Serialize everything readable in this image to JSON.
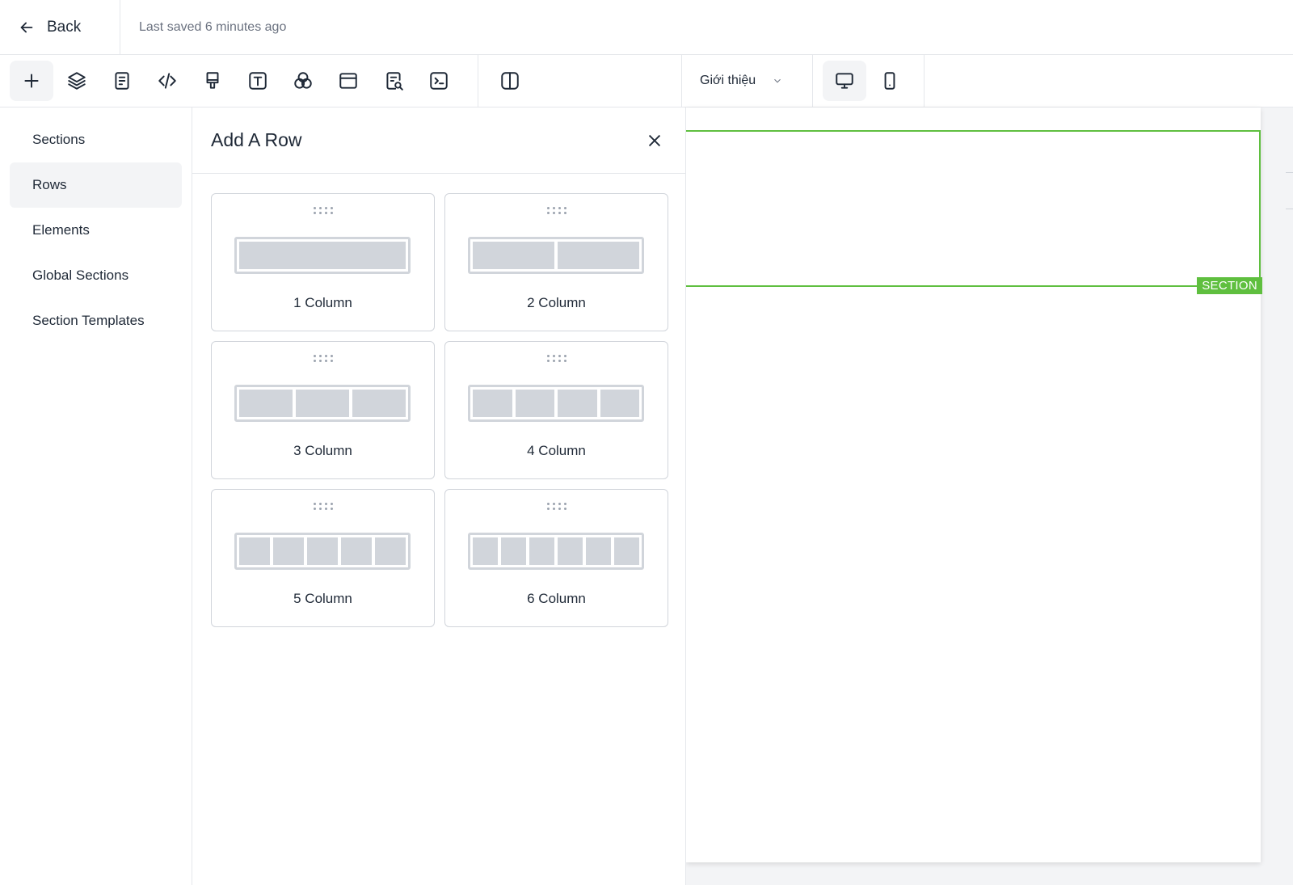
{
  "header": {
    "back_label": "Back",
    "saved_status": "Last saved 6 minutes ago"
  },
  "toolbar": {
    "tools": [
      {
        "icon": "plus-icon",
        "active": true
      },
      {
        "icon": "layers-icon"
      },
      {
        "icon": "page-icon"
      },
      {
        "icon": "code-icon"
      },
      {
        "icon": "paint-brush-icon"
      },
      {
        "icon": "text-icon"
      },
      {
        "icon": "color-circles-icon"
      },
      {
        "icon": "browser-window-icon"
      },
      {
        "icon": "search-document-icon"
      },
      {
        "icon": "terminal-icon"
      },
      {
        "icon": "split-view-icon"
      }
    ],
    "page_select": {
      "selected": "Giới thiệu"
    },
    "devices": [
      {
        "icon": "desktop-icon",
        "active": true
      },
      {
        "icon": "mobile-icon"
      }
    ]
  },
  "left_nav": {
    "items": [
      {
        "label": "Sections"
      },
      {
        "label": "Rows",
        "active": true
      },
      {
        "label": "Elements"
      },
      {
        "label": "Global Sections"
      },
      {
        "label": "Section Templates"
      }
    ]
  },
  "panel": {
    "title": "Add A Row",
    "rows": [
      {
        "label": "1 Column",
        "columns": 1
      },
      {
        "label": "2 Column",
        "columns": 2
      },
      {
        "label": "3 Column",
        "columns": 3
      },
      {
        "label": "4 Column",
        "columns": 4
      },
      {
        "label": "5 Column",
        "columns": 5
      },
      {
        "label": "6 Column",
        "columns": 6
      }
    ]
  },
  "canvas": {
    "section_tag": "SECTION",
    "accent_color": "#5fbf3f"
  }
}
